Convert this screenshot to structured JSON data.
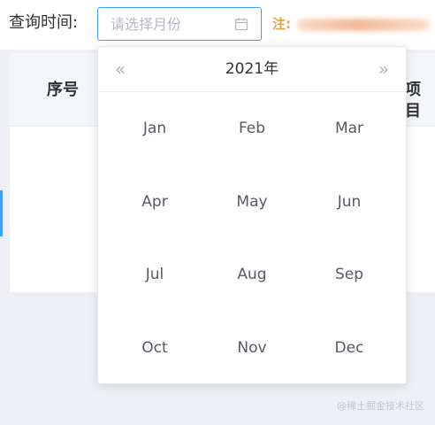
{
  "query": {
    "label": "查询时间:",
    "placeholder": "请选择月份",
    "icon": "calendar-icon",
    "note_label": "注:"
  },
  "table": {
    "columns": [
      "序号",
      "项目"
    ],
    "visible_header_texts": [
      "序号",
      "项目"
    ]
  },
  "month_picker": {
    "year_label": "2021年",
    "prev_icon": "«",
    "next_icon": "»",
    "months": [
      "Jan",
      "Feb",
      "Mar",
      "Apr",
      "May",
      "Jun",
      "Jul",
      "Aug",
      "Sep",
      "Oct",
      "Nov",
      "Dec"
    ]
  },
  "watermark": "@稀土掘金技术社区",
  "colors": {
    "accent": "#409eff",
    "note": "#e6a23c",
    "background": "#eef0f5",
    "panel": "#ffffff",
    "header_bg": "#f5f6f8"
  }
}
